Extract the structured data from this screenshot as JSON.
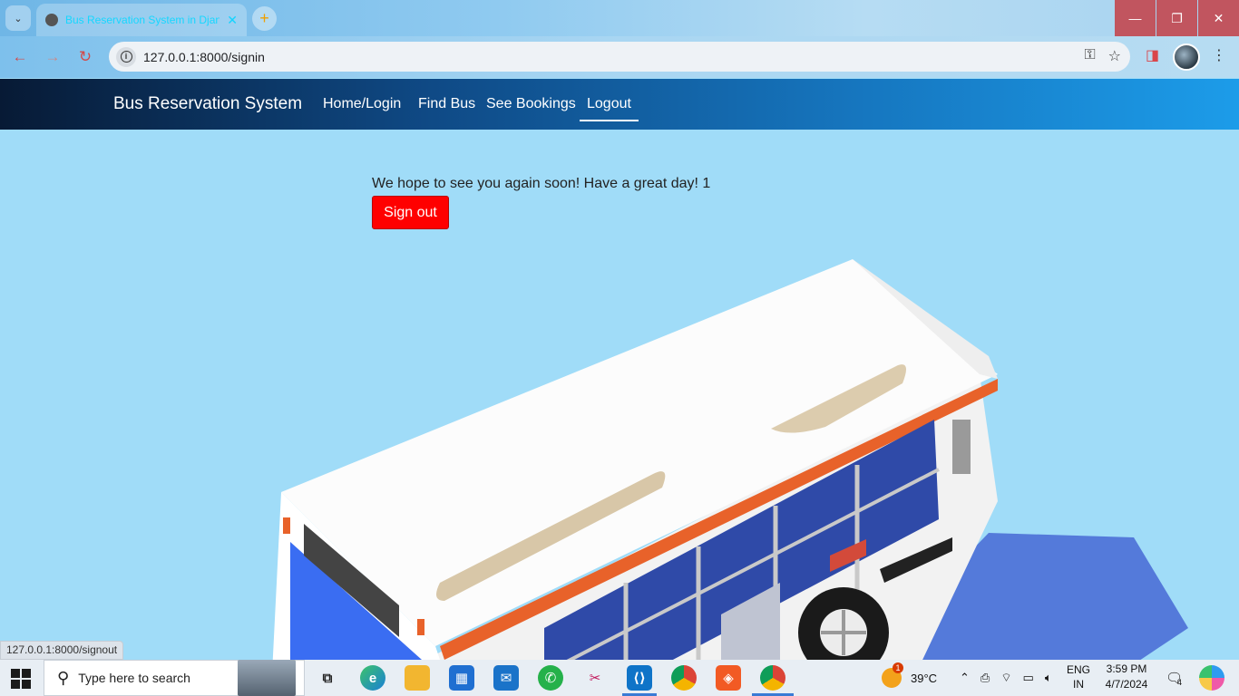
{
  "browser": {
    "tab_title": "Bus Reservation System in Django",
    "new_tab_label": "+",
    "address_url": "127.0.0.1:8000/signin",
    "status_url": "127.0.0.1:8000/signout",
    "window_controls": {
      "minimize": "—",
      "restore": "❐",
      "close": "✕"
    }
  },
  "navbar": {
    "brand": "Bus Reservation System",
    "links": [
      "Home/Login",
      "Find Bus",
      "See Bookings",
      "Logout"
    ],
    "active": "Logout"
  },
  "main": {
    "message": "We hope to see you again soon! Have a great day! 1",
    "signout_label": "Sign out"
  },
  "taskbar": {
    "search_placeholder": "Type here to search",
    "weather_temp": "39°C",
    "lang_top": "ENG",
    "lang_bottom": "IN",
    "time": "3:59 PM",
    "date": "4/7/2024",
    "notification_count": "4",
    "weather_badge": "1"
  },
  "colors": {
    "page_bg": "#a0dcf8",
    "signout_button": "#ff0000",
    "navbar_start": "#071a35",
    "navbar_end": "#1c9ce9"
  }
}
